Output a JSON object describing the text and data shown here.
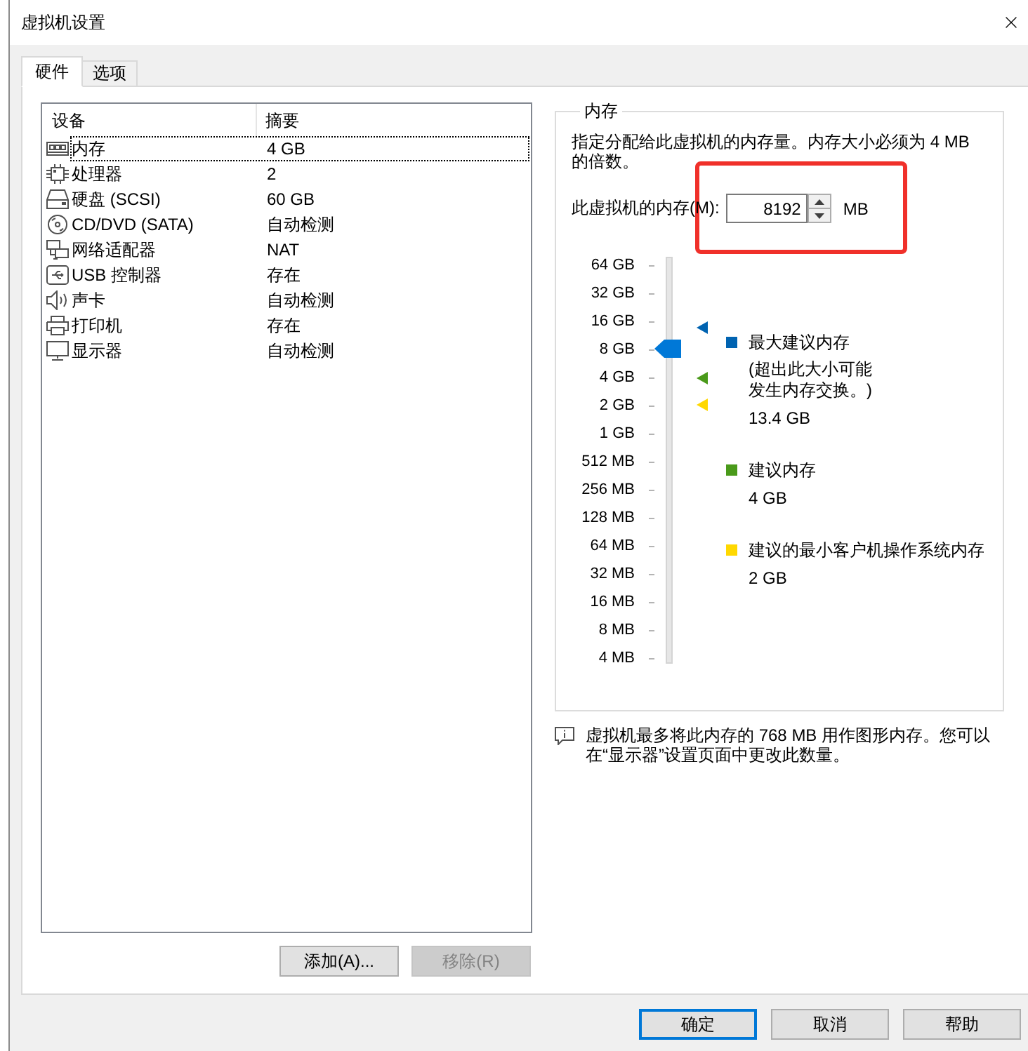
{
  "window": {
    "title": "虚拟机设置"
  },
  "tabs": [
    {
      "label": "硬件",
      "selected": true
    },
    {
      "label": "选项",
      "selected": false
    }
  ],
  "device_list": {
    "columns": [
      "设备",
      "摘要"
    ],
    "rows": [
      {
        "kind": "memory",
        "device": "内存",
        "summary": "4 GB",
        "selected": true
      },
      {
        "kind": "processor",
        "device": "处理器",
        "summary": "2",
        "selected": false
      },
      {
        "kind": "disk",
        "device": "硬盘 (SCSI)",
        "summary": "60 GB",
        "selected": false
      },
      {
        "kind": "cdrom",
        "device": "CD/DVD (SATA)",
        "summary": "自动检测",
        "selected": false
      },
      {
        "kind": "network",
        "device": "网络适配器",
        "summary": "NAT",
        "selected": false
      },
      {
        "kind": "usb",
        "device": "USB 控制器",
        "summary": "存在",
        "selected": false
      },
      {
        "kind": "sound",
        "device": "声卡",
        "summary": "自动检测",
        "selected": false
      },
      {
        "kind": "printer",
        "device": "打印机",
        "summary": "存在",
        "selected": false
      },
      {
        "kind": "display",
        "device": "显示器",
        "summary": "自动检测",
        "selected": false
      }
    ]
  },
  "device_buttons": [
    {
      "label": "添加(A)...",
      "disabled": false
    },
    {
      "label": "移除(R)",
      "disabled": true
    }
  ],
  "memory": {
    "title": "内存",
    "description": "指定分配给此虚拟机的内存量。内存大小必须为 4 MB 的倍数。",
    "field_label": "此虚拟机的内存(M):",
    "value": "8192",
    "unit": "MB",
    "slider": {
      "scale": [
        "64 GB",
        "32 GB",
        "16 GB",
        "8 GB",
        "4 GB",
        "2 GB",
        "1 GB",
        "512 MB",
        "256 MB",
        "128 MB",
        "64 MB",
        "32 MB",
        "16 MB",
        "8 MB",
        "4 MB"
      ],
      "level": 0.786,
      "marks": [
        {
          "color": "#0063b1",
          "level": 0.84
        },
        {
          "color": "#4a9a1a",
          "level": 0.714
        },
        {
          "color": "#ffd800",
          "level": 0.643
        }
      ]
    },
    "legend": [
      {
        "label": "最大建议内存",
        "note": "(超出此大小可能发生内存交换。)",
        "value": "13.4 GB",
        "color": "#0063b1"
      },
      {
        "label": "建议内存",
        "value": "4 GB",
        "color": "#4a9a1a"
      },
      {
        "label": "建议的最小客户机操作系统内存",
        "value": "2 GB",
        "color": "#ffd800"
      }
    ]
  },
  "info": "虚拟机最多将此内存的 768 MB 用作图形内存。您可以在“显示器”设置页面中更改此数量。",
  "highlight_box": true,
  "dialog_buttons": [
    {
      "label": "确定",
      "focused": true
    },
    {
      "label": "取消",
      "focused": false
    },
    {
      "label": "帮助",
      "focused": false
    }
  ]
}
